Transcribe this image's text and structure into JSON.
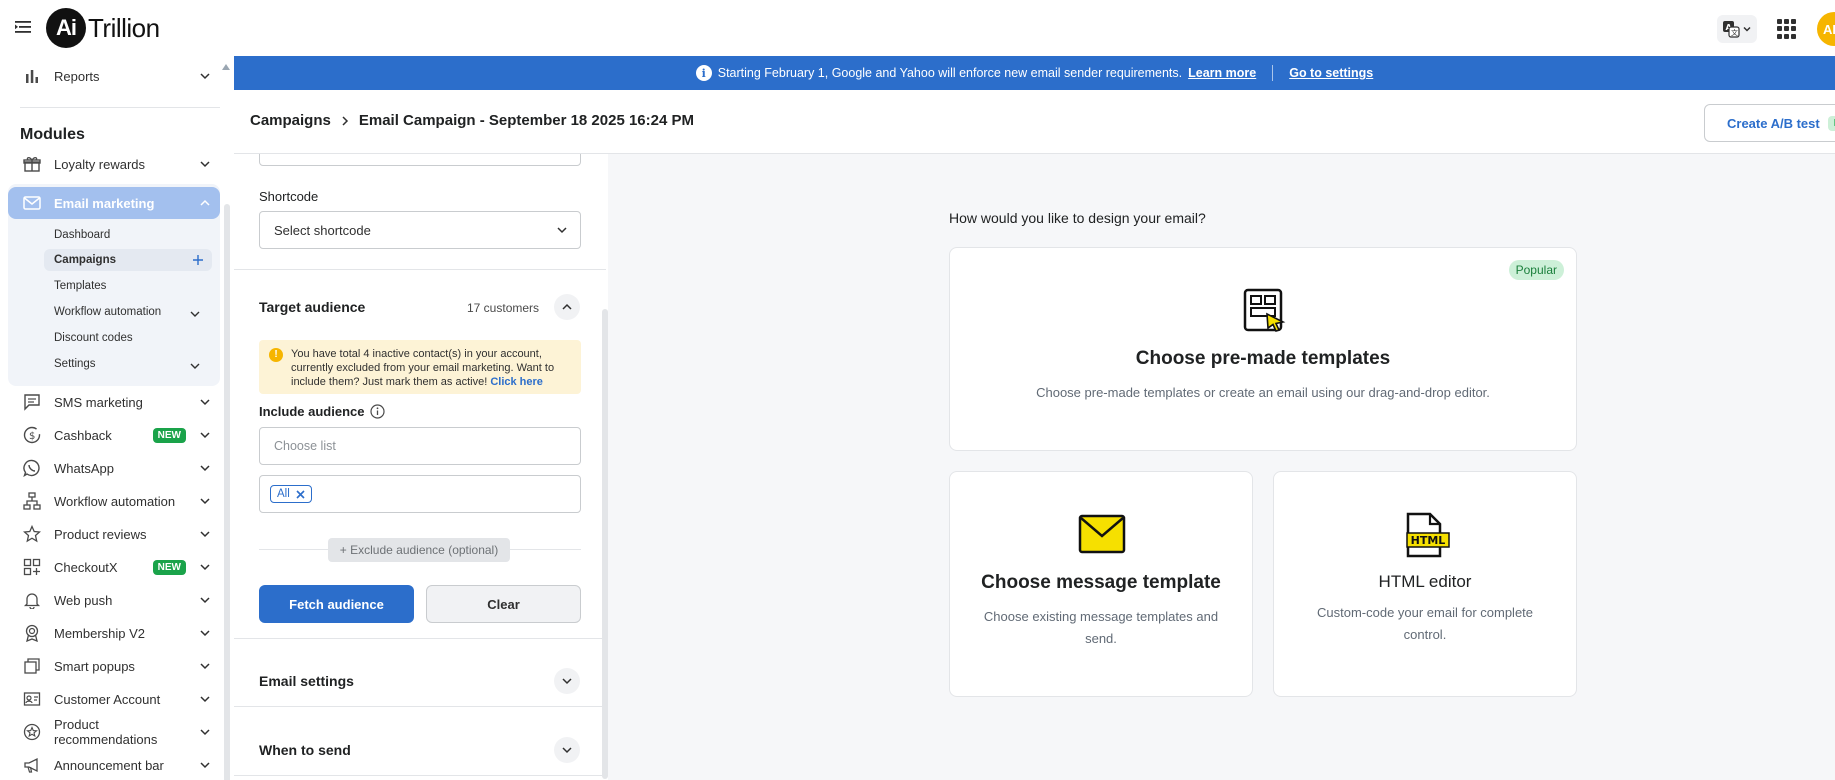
{
  "app": {
    "logo_mark": "Ai",
    "logo_name": "Trillion",
    "avatar_initials": "AL"
  },
  "topbar": {
    "menu_icon": "hamburger-icon",
    "translate_icon": "translate-icon",
    "apps_icon": "apps-grid-icon"
  },
  "sidebar": {
    "reports": "Reports",
    "modules_title": "Modules",
    "loyalty": "Loyalty rewards",
    "email_marketing": "Email marketing",
    "email_sub": {
      "dashboard": "Dashboard",
      "campaigns": "Campaigns",
      "templates": "Templates",
      "workflow": "Workflow automation",
      "discount": "Discount codes",
      "settings": "Settings"
    },
    "sms": "SMS marketing",
    "cashback": "Cashback",
    "whatsapp": "WhatsApp",
    "workflow": "Workflow automation",
    "reviews": "Product reviews",
    "checkoutx": "CheckoutX",
    "webpush": "Web push",
    "membership": "Membership V2",
    "popups": "Smart popups",
    "customer": "Customer Account",
    "recommendations": "Product recommendations",
    "announcement": "Announcement bar",
    "new_badge": "NEW"
  },
  "banner": {
    "text": "Starting February 1, Google and Yahoo will enforce new email sender requirements.",
    "learn_more": "Learn more",
    "go_settings": "Go to settings"
  },
  "header": {
    "crumb_root": "Campaigns",
    "crumb_current": "Email Campaign - September 18 2025 16:24 PM",
    "ab_button": "Create A/B test",
    "ab_tag": "N"
  },
  "form": {
    "shortcode_label": "Shortcode",
    "shortcode_value": "Select shortcode",
    "target_title": "Target audience",
    "customer_count": "17 customers",
    "warning_text": "You have total 4 inactive contact(s) in your account, currently excluded from your email marketing. Want to include them? Just mark them as active!",
    "warning_link": "Click here",
    "include_label": "Include audience",
    "choose_list_placeholder": "Choose list",
    "chip_all": "All",
    "exclude_button": "+ Exclude audience (optional)",
    "fetch_button": "Fetch audience",
    "clear_button": "Clear",
    "email_settings": "Email settings",
    "when_to_send": "When to send"
  },
  "design": {
    "question": "How would you like to design your email?",
    "premade_title": "Choose pre-made templates",
    "premade_desc": "Choose pre-made templates or create an email using our drag-and-drop editor.",
    "popular": "Popular",
    "message_title": "Choose message template",
    "message_desc": "Choose existing message templates and send.",
    "html_title": "HTML editor",
    "html_desc": "Custom-code your email for complete control.",
    "html_icon_text": "HTML"
  },
  "colors": {
    "brand_blue": "#2c6ecb",
    "accent_yellow": "#f6e000",
    "new_green": "#1aa34a",
    "sidebar_active": "#a3c0ee"
  }
}
